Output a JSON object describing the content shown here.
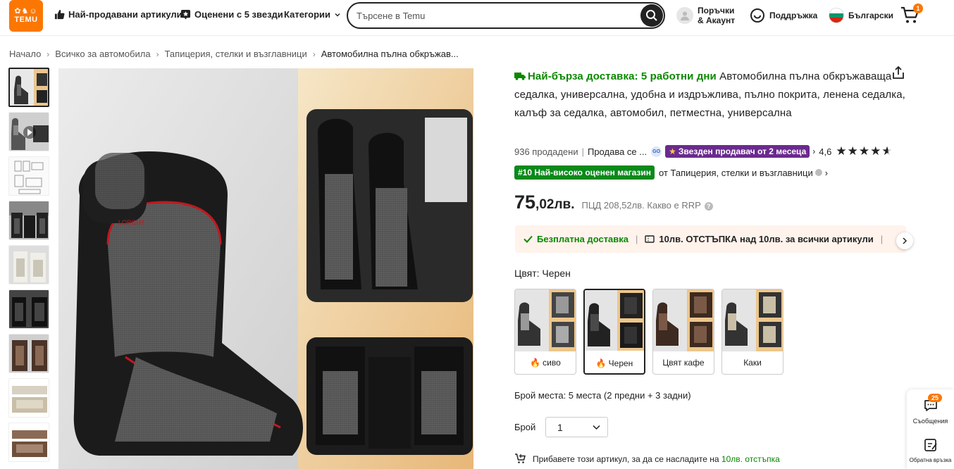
{
  "header": {
    "logo_text": "TEMU",
    "nav": {
      "bestsellers": "Най-продавани артикули",
      "five_stars": "Оценени с 5 звезди",
      "categories": "Категории"
    },
    "search_placeholder": "Търсене в Temu",
    "account": {
      "line1": "Поръчки",
      "line2": "& Акаунт"
    },
    "support": "Поддръжка",
    "language": "Български",
    "cart_count": "1"
  },
  "breadcrumb": [
    "Начало",
    "Всичко за автомобила",
    "Тапицерия, стелки и възглавници",
    "Автомобилна пълна обкръжав..."
  ],
  "product": {
    "fast_delivery": "Най-бърза доставка: 5 работни дни",
    "title": "Автомобилна пълна обкръжаваща седалка, универсална, удобна и издръжлива, пълно покрита, ленена седалка, калъф за седалка, автомобил, петместна, универсална",
    "sold": "936 продадени",
    "seller": "Продава се ...",
    "go_badge": "GO",
    "star_seller": "Звезден продавач от 2 месеца",
    "rating": "4,6",
    "rating_value": 4.6,
    "rank_badge": "#10 Най-високо оценен магазин",
    "rank_text": "от Тапицерия, стелки и възглавници",
    "price_main": "75",
    "price_decimal": ",02лв.",
    "rrp_label": "ПЦД",
    "rrp_value": "208,52лв.",
    "rrp_question": "Какво е RRP",
    "promo_free": "Безплатна доставка",
    "promo_discount": "10лв. ОТСТЪПКА над 10лв. за всички артикули",
    "color_label": "Цвят: Черен",
    "swatches": [
      {
        "label": "сиво",
        "hot": true
      },
      {
        "label": "Черен",
        "hot": true
      },
      {
        "label": "Цвят кафе",
        "hot": false
      },
      {
        "label": "Каки",
        "hot": false
      }
    ],
    "seats": "Брой места: 5 места (2 предни + 3 задни)",
    "qty_label": "Брой",
    "qty_value": "1",
    "add_note_prefix": "Прибавете този артикул, за да се насладите на",
    "add_note_green": "10лв. отстъпка"
  },
  "floating": {
    "messages_count": "25",
    "messages": "Съобщения",
    "feedback": "Обратна връзка"
  },
  "colors": {
    "brand_orange": "#fb7701",
    "green": "#0a8800",
    "star_seller_purple": "#6b2a8f",
    "promo_bg": "#fff3ec"
  }
}
